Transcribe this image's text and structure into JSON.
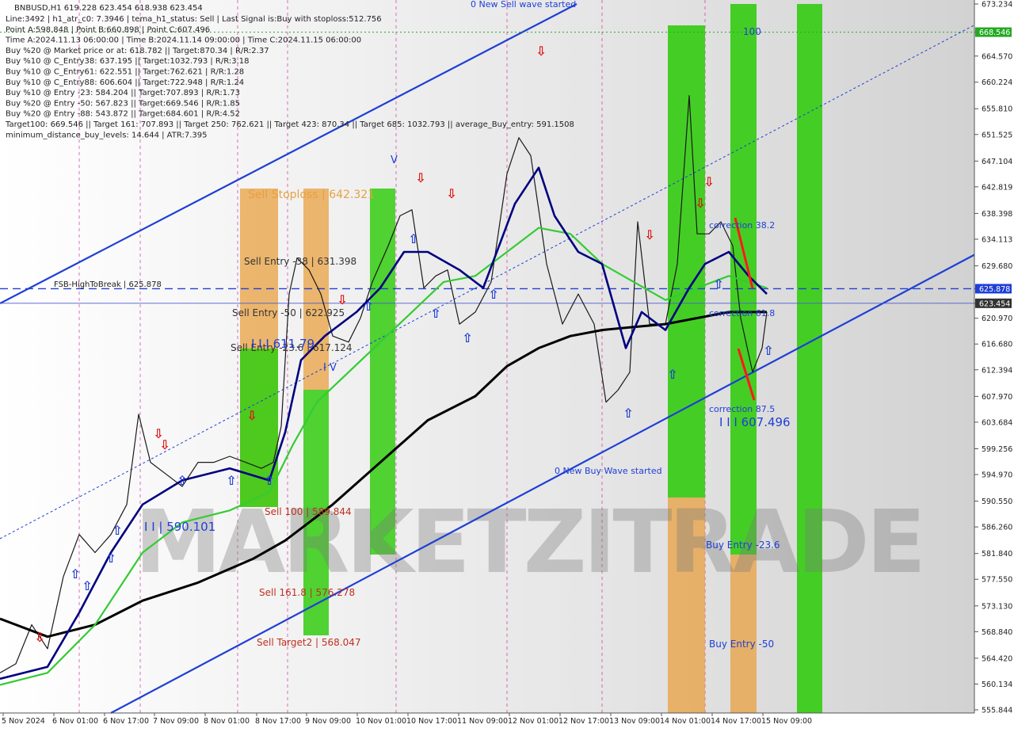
{
  "chart_data": {
    "type": "candlestick",
    "symbol": "BNBUSD",
    "timeframe": "H1",
    "header": {
      "quote_line": "BNBUSD,H1  619.228 623.454 618.938 623.454",
      "info_lines": [
        "Line:3492 | h1_atr_c0: 7.3946 | tema_h1_status: Sell | Last Signal is:Buy with stoploss:512.756",
        "Point A:598.848 | Point B:660.898 | Point C:607.496",
        "Time A:2024.11.13 06:00:00 | Time B:2024.11.14 09:00:00 | Time C:2024.11.15 06:00:00",
        "Buy %20 @ Market price or at: 618.782 || Target:870.34 | R/R:2.37",
        "Buy %10 @ C_Entry38: 637.195 || Target:1032.793 | R/R:3.18",
        "Buy %10 @ C_Entry61: 622.551 || Target:762.621 | R/R:1.28",
        "Buy %10 @ C_Entry88: 606.604 || Target:722.948 | R/R:1.24",
        "Buy %10 @ Entry -23: 584.204 || Target:707.893 | R/R:1.73",
        "Buy %20 @ Entry -50: 567.823 || Target:669.546 | R/R:1.85",
        "Buy %20 @ Entry -88: 543.872 || Target:684.601 | R/R:4.52",
        "Target100: 669.546 || Target 161: 707.893 || Target 250: 762.621 || Target 423: 870.34 || Target 685: 1032.793 || average_Buy_entry: 591.1508",
        "minimum_distance_buy_levels: 14.644 | ATR:7.395"
      ]
    },
    "y_axis": {
      "min": 555.844,
      "max": 673.234,
      "ticks": [
        673.234,
        668.546,
        664.57,
        660.224,
        655.81,
        651.525,
        647.104,
        642.819,
        638.398,
        634.113,
        629.68,
        625.878,
        623.454,
        620.97,
        616.68,
        612.394,
        607.97,
        603.684,
        599.256,
        594.97,
        590.55,
        586.26,
        581.84,
        577.55,
        573.13,
        568.84,
        564.42,
        560.134,
        555.844
      ],
      "tick_labels": [
        "673.234",
        "",
        "664.570",
        "660.224",
        "655.810",
        "651.525",
        "647.104",
        "642.819",
        "638.398",
        "634.113",
        "629.680",
        "",
        "",
        "620.970",
        "616.680",
        "612.394",
        "607.970",
        "603.684",
        "599.256",
        "594.970",
        "590.550",
        "586.260",
        "581.840",
        "577.550",
        "573.130",
        "568.840",
        "564.420",
        "560.134",
        "555.844"
      ],
      "markers": [
        {
          "label": "668.546",
          "value": 668.546,
          "color": "#22aa22"
        },
        {
          "label": "625.878",
          "value": 625.878,
          "color": "#1f3fd6"
        },
        {
          "label": "623.454",
          "value": 623.454,
          "color": "#333333"
        }
      ]
    },
    "x_axis": {
      "tick_labels": [
        "5 Nov 2024",
        "6 Nov 01:00",
        "6 Nov 17:00",
        "7 Nov 09:00",
        "8 Nov 01:00",
        "8 Nov 17:00",
        "9 Nov 09:00",
        "10 Nov 01:00",
        "10 Nov 17:00",
        "11 Nov 09:00",
        "12 Nov 01:00",
        "12 Nov 17:00",
        "13 Nov 09:00",
        "14 Nov 01:00",
        "14 Nov 17:00",
        "15 Nov 09:00"
      ]
    },
    "series": [
      {
        "name": "price",
        "points": [
          [
            0,
            562.0
          ],
          [
            20,
            563.5
          ],
          [
            40,
            570.0
          ],
          [
            60,
            566.0
          ],
          [
            80,
            578.0
          ],
          [
            100,
            585.0
          ],
          [
            120,
            582.0
          ],
          [
            140,
            585.0
          ],
          [
            160,
            590.0
          ],
          [
            175,
            605.0
          ],
          [
            190,
            597.0
          ],
          [
            210,
            595.0
          ],
          [
            230,
            593.0
          ],
          [
            250,
            597.0
          ],
          [
            270,
            597.0
          ],
          [
            290,
            598.0
          ],
          [
            310,
            597.0
          ],
          [
            330,
            596.0
          ],
          [
            345,
            597.0
          ],
          [
            355,
            603.0
          ],
          [
            365,
            625.0
          ],
          [
            375,
            631.0
          ],
          [
            390,
            629.0
          ],
          [
            405,
            625.0
          ],
          [
            420,
            618.0
          ],
          [
            440,
            617.0
          ],
          [
            455,
            621.0
          ],
          [
            470,
            627.0
          ],
          [
            490,
            633.0
          ],
          [
            505,
            638.0
          ],
          [
            520,
            639.0
          ],
          [
            535,
            626.0
          ],
          [
            550,
            628.0
          ],
          [
            565,
            629.0
          ],
          [
            580,
            620.0
          ],
          [
            600,
            622.0
          ],
          [
            620,
            627.0
          ],
          [
            640,
            645.0
          ],
          [
            655,
            651.0
          ],
          [
            670,
            648.0
          ],
          [
            690,
            630.0
          ],
          [
            710,
            620.0
          ],
          [
            730,
            625.0
          ],
          [
            750,
            620.0
          ],
          [
            765,
            607.0
          ],
          [
            780,
            609.0
          ],
          [
            795,
            612.0
          ],
          [
            805,
            637.0
          ],
          [
            820,
            620.0
          ],
          [
            840,
            620.0
          ],
          [
            855,
            630.0
          ],
          [
            870,
            658.0
          ],
          [
            880,
            635.0
          ],
          [
            895,
            635.0
          ],
          [
            910,
            637.0
          ],
          [
            925,
            633.0
          ],
          [
            935,
            621.0
          ],
          [
            950,
            612.0
          ],
          [
            962,
            616.0
          ],
          [
            968,
            622.0
          ]
        ]
      },
      {
        "name": "",
        "points": [
          [
            0,
            571.0
          ],
          [
            60,
            568.0
          ],
          [
            120,
            570.0
          ],
          [
            180,
            574.0
          ],
          [
            250,
            577.0
          ],
          [
            320,
            581.0
          ],
          [
            360,
            584.0
          ],
          [
            420,
            590.0
          ],
          [
            480,
            597.0
          ],
          [
            540,
            604.0
          ],
          [
            600,
            608.0
          ],
          [
            640,
            613.0
          ],
          [
            680,
            616.0
          ],
          [
            720,
            618.0
          ],
          [
            760,
            619.0
          ],
          [
            800,
            619.5
          ],
          [
            840,
            620.0
          ],
          [
            880,
            621.0
          ],
          [
            920,
            622.0
          ],
          [
            968,
            622.0
          ]
        ]
      },
      {
        "name": "",
        "points": [
          [
            0,
            560.0
          ],
          [
            60,
            562.0
          ],
          [
            120,
            570.0
          ],
          [
            180,
            582.0
          ],
          [
            230,
            587.0
          ],
          [
            290,
            589.0
          ],
          [
            340,
            592.0
          ],
          [
            370,
            600.0
          ],
          [
            400,
            607.0
          ],
          [
            440,
            612.0
          ],
          [
            480,
            617.0
          ],
          [
            520,
            622.0
          ],
          [
            560,
            627.0
          ],
          [
            600,
            628.0
          ],
          [
            640,
            632.0
          ],
          [
            680,
            636.0
          ],
          [
            720,
            635.0
          ],
          [
            760,
            630.0
          ],
          [
            800,
            627.0
          ],
          [
            840,
            624.0
          ],
          [
            880,
            626.0
          ],
          [
            920,
            628.0
          ],
          [
            968,
            626.0
          ]
        ]
      },
      {
        "name": "",
        "points": [
          [
            0,
            561.0
          ],
          [
            60,
            563.0
          ],
          [
            100,
            572.0
          ],
          [
            140,
            582.0
          ],
          [
            180,
            590.0
          ],
          [
            230,
            594.0
          ],
          [
            290,
            596.0
          ],
          [
            340,
            594.0
          ],
          [
            360,
            602.0
          ],
          [
            380,
            614.0
          ],
          [
            410,
            618.0
          ],
          [
            450,
            622.0
          ],
          [
            480,
            626.0
          ],
          [
            510,
            632.0
          ],
          [
            540,
            632.0
          ],
          [
            580,
            629.0
          ],
          [
            610,
            626.0
          ],
          [
            650,
            640.0
          ],
          [
            680,
            646.0
          ],
          [
            700,
            638.0
          ],
          [
            730,
            632.0
          ],
          [
            760,
            630.0
          ],
          [
            790,
            616.0
          ],
          [
            810,
            622.0
          ],
          [
            840,
            619.0
          ],
          [
            870,
            626.0
          ],
          [
            890,
            630.0
          ],
          [
            920,
            632.0
          ],
          [
            945,
            628.0
          ],
          [
            968,
            625.0
          ]
        ]
      }
    ],
    "zones": [
      {
        "label": "Sell Stoploss | 642.321",
        "color": "#e8a040"
      },
      {
        "label": "Sell Entry -38 | 631.398",
        "color": "#333333"
      },
      {
        "label": "Sell Entry -50 | 622.925",
        "color": "#333333"
      },
      {
        "label": "Sell Entry -23.6 | 617.124",
        "color": "#333333"
      },
      {
        "label": "Sell 100 | 589.844",
        "color": "#c03020"
      },
      {
        "label": "Sell 161.8 | 576.278",
        "color": "#c03020"
      },
      {
        "label": "Sell Target2 | 568.047",
        "color": "#c03020"
      }
    ],
    "annotations": [
      "0 New Sell wave started",
      "0 New Buy Wave started",
      "FSB-HighToBreak | 625.878",
      "I I I 611.79",
      "I V",
      "I I | 590.101",
      "correction 38.2",
      "correction 61.8",
      "correction 87.5",
      "I I I 607.496",
      "Buy Entry -23.6",
      "Buy Entry -50",
      "100",
      "V"
    ],
    "watermark": "MARKETZITRADE",
    "colors": {
      "ema_fast": "#000080",
      "ema_green": "#33cc33",
      "ema_slow": "#000000",
      "channel": "#1f3fd6",
      "sell_zone": "#e8a040",
      "buy_zone": "#33cc11",
      "price": "#1a1a1a",
      "stop": "#ff4400"
    }
  }
}
